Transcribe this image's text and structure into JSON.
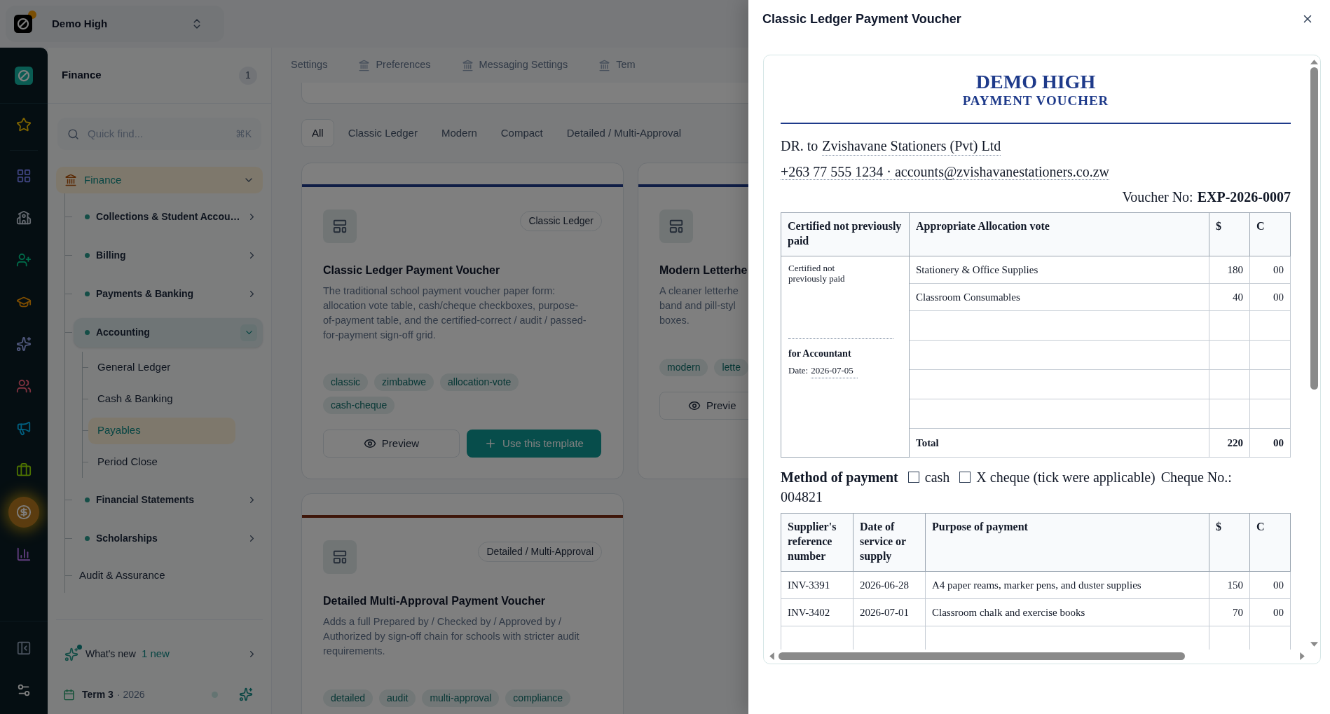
{
  "workspace": {
    "name": "Demo High"
  },
  "rail": {
    "items": [
      {
        "selected": false
      },
      {
        "selected": false
      },
      {
        "selected": false
      },
      {
        "selected": false
      },
      {
        "selected": false
      },
      {
        "selected": false
      },
      {
        "selected": false
      },
      {
        "selected": false
      },
      {
        "selected": false
      },
      {
        "selected": true
      },
      {
        "selected": false
      }
    ]
  },
  "sidebar": {
    "title": "Finance",
    "badge": "1",
    "search": {
      "placeholder": "Quick find...",
      "shortcut": "⌘K"
    },
    "tree": [
      {
        "label": "Finance",
        "kind": "section",
        "expanded": true,
        "children": [
          {
            "label": "Collections & Student Accou…",
            "kind": "group",
            "expanded": false
          },
          {
            "label": "Billing",
            "kind": "group",
            "expanded": false
          },
          {
            "label": "Payments & Banking",
            "kind": "group",
            "expanded": false
          },
          {
            "label": "Accounting",
            "kind": "group",
            "expanded": true,
            "children": [
              {
                "label": "General Ledger",
                "selected": false
              },
              {
                "label": "Cash & Banking",
                "selected": false
              },
              {
                "label": "Payables",
                "selected": true
              },
              {
                "label": "Period Close",
                "selected": false
              }
            ]
          },
          {
            "label": "Financial Statements",
            "kind": "group",
            "expanded": false
          },
          {
            "label": "Scholarships",
            "kind": "group",
            "expanded": false
          },
          {
            "label": "Audit & Assurance",
            "kind": "link",
            "selected": false
          }
        ]
      }
    ],
    "whats_new": {
      "label": "What's new",
      "count": "1 new"
    },
    "term": {
      "label": "Term 3",
      "year": "· 2026"
    }
  },
  "main": {
    "tabs": [
      {
        "label": "Settings",
        "selected": false
      },
      {
        "label": "Preferences",
        "selected": false
      },
      {
        "label": "Messaging Settings",
        "selected": false
      },
      {
        "label": "Tem",
        "selected": false
      }
    ],
    "filters": [
      {
        "label": "All",
        "selected": true
      },
      {
        "label": "Classic Ledger",
        "selected": false
      },
      {
        "label": "Modern",
        "selected": false
      },
      {
        "label": "Compact",
        "selected": false
      },
      {
        "label": "Detailed / Multi-Approval",
        "selected": false
      }
    ],
    "cards": [
      {
        "color": "#0f1d45",
        "badge": "Classic Ledger",
        "title": "Classic Ledger Payment Voucher",
        "description": "The traditional school payment voucher paper form: allocation vote table, cash/cheque checkboxes, purpose-of-payment table, and the certified-correct / audit / passed-for-payment sign-off grid.",
        "tags": [
          "classic",
          "zimbabwe",
          "allocation-vote",
          "cash-cheque"
        ],
        "preview": "Preview",
        "use": "Use this template"
      },
      {
        "color": "#0f1d45",
        "title": "Modern Letterhe",
        "description": "A cleaner letterhe\nband and pill-styl\nboxes.",
        "tags": [
          "modern",
          "lette"
        ],
        "preview": "Previe"
      },
      {
        "color": "#3e1609",
        "badge": "Detailed / Multi-Approval",
        "title": "Detailed Multi-Approval Payment Voucher",
        "description": "Adds a full Prepared by / Checked by / Approved by / Authorized by sign-off chain for schools with stricter audit requirements.",
        "tags": [
          "detailed",
          "audit",
          "multi-approval",
          "compliance"
        ]
      }
    ]
  },
  "drawer": {
    "title": "Classic Ledger Payment Voucher",
    "voucher": {
      "school": "DEMO HIGH",
      "heading": "PAYMENT VOUCHER",
      "payee_prefix": "DR. to",
      "payee": "Zvishavane Stationers (Pvt) Ltd",
      "contact": "+263 77 555 1234 · accounts@zvishavanestationers.co.zw",
      "voucher_label": "Voucher No:",
      "voucher_no": "EXP-2026-0007",
      "allocation": {
        "columns": [
          "Certified not previously paid",
          "Appropriate Allocation vote",
          "$",
          "C"
        ],
        "certified": "Certified not previously paid",
        "signatory": "for Accountant",
        "date_label": "Date:",
        "date": "2026-07-05",
        "rows": [
          {
            "vote": "Stationery & Office Supplies",
            "dollars": "180",
            "cents": "00"
          },
          {
            "vote": "Classroom Consumables",
            "dollars": "40",
            "cents": "00"
          }
        ],
        "total": {
          "label": "Total",
          "dollars": "220",
          "cents": "00"
        }
      },
      "method": {
        "label": "Method of payment",
        "options": [
          {
            "label": "cash",
            "checked": false
          },
          {
            "label": "X cheque (tick were applicable)",
            "checked": false
          }
        ],
        "cheque_label": "Cheque No.:",
        "cheque_no": "004821"
      },
      "purpose": {
        "columns": [
          "Supplier's reference number",
          "Date of service or supply",
          "Purpose of payment",
          "$",
          "C"
        ],
        "rows": [
          {
            "ref": "INV-3391",
            "date": "2026-06-28",
            "purpose": "A4 paper reams, marker pens, and duster supplies",
            "dollars": "150",
            "cents": "00"
          },
          {
            "ref": "INV-3402",
            "date": "2026-07-01",
            "purpose": "Classroom chalk and exercise books",
            "dollars": "70",
            "cents": "00"
          }
        ]
      }
    }
  }
}
